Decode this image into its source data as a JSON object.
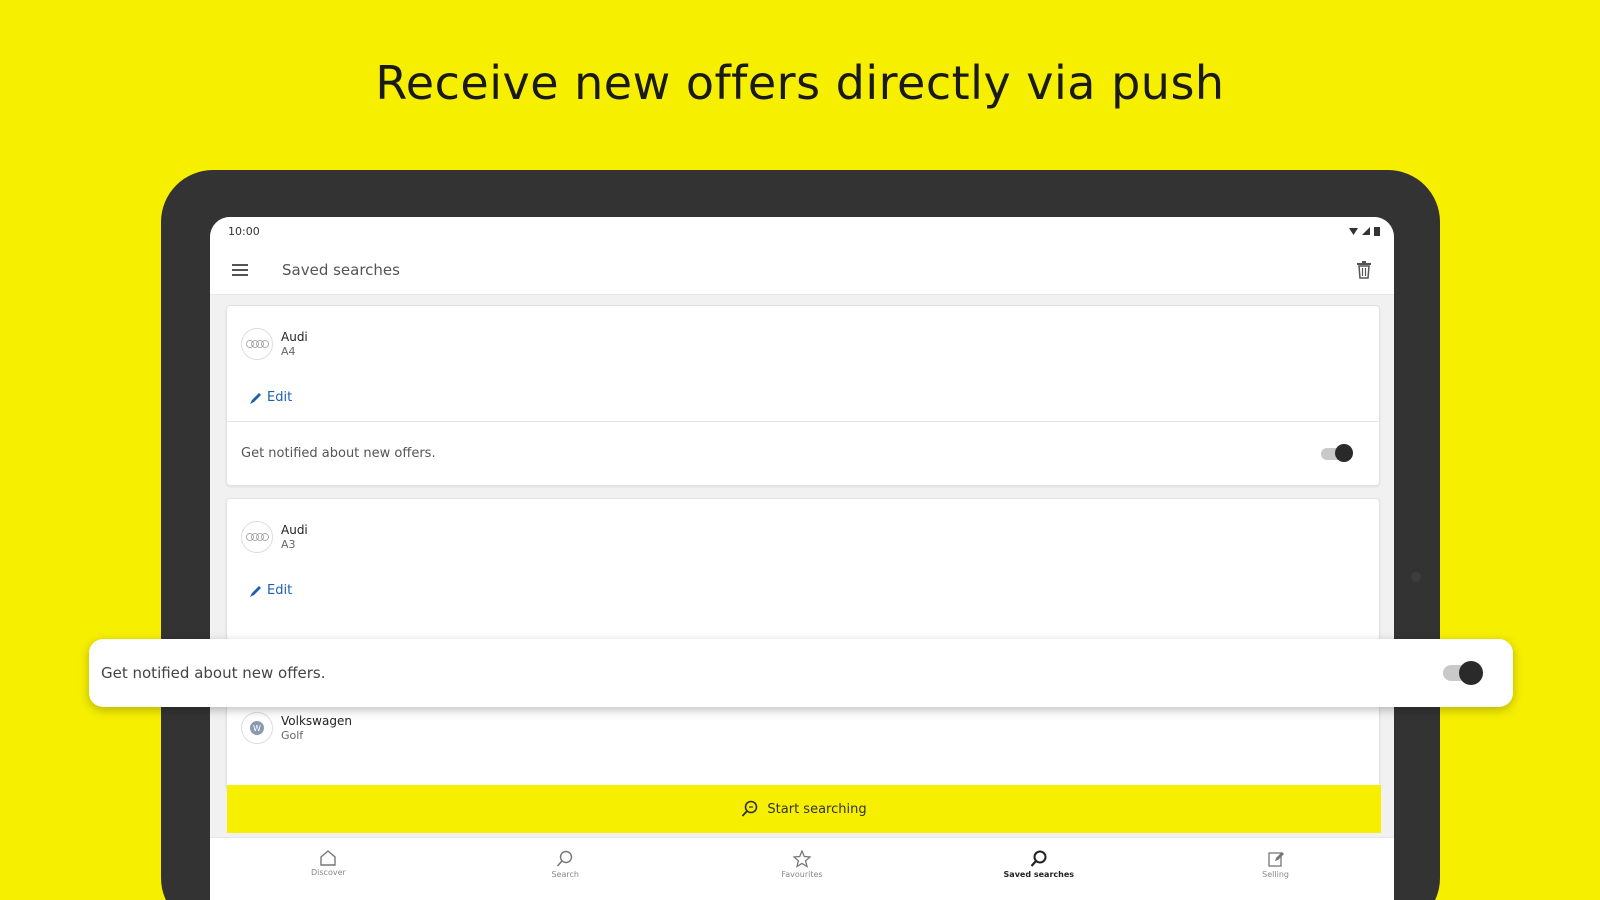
{
  "headline": "Receive new offers directly via push",
  "status_bar": {
    "time": "10:00"
  },
  "app_bar": {
    "title": "Saved searches",
    "menu_icon": "hamburger-icon",
    "trash_icon": "trash-icon"
  },
  "cards": [
    {
      "make": "Audi",
      "model": "A4",
      "edit_label": "Edit",
      "notify_label": "Get notified about new offers.",
      "notify_on": true
    },
    {
      "make": "Audi",
      "model": "A3",
      "edit_label": "Edit"
    },
    {
      "make": "Volkswagen",
      "model": "Golf"
    }
  ],
  "floating_row": {
    "label": "Get notified about new offers.",
    "notify_on": true
  },
  "start_button": {
    "label": "Start searching"
  },
  "bottom_nav": [
    {
      "label": "Discover",
      "icon": "home-icon"
    },
    {
      "label": "Search",
      "icon": "search-icon"
    },
    {
      "label": "Favourites",
      "icon": "star-icon"
    },
    {
      "label": "Saved searches",
      "icon": "saved-search-icon",
      "active": true
    },
    {
      "label": "Selling",
      "icon": "edit-icon"
    }
  ],
  "colors": {
    "brand_yellow": "#f6ef00",
    "device_frame": "#333333",
    "link_blue": "#1c5fb5"
  }
}
